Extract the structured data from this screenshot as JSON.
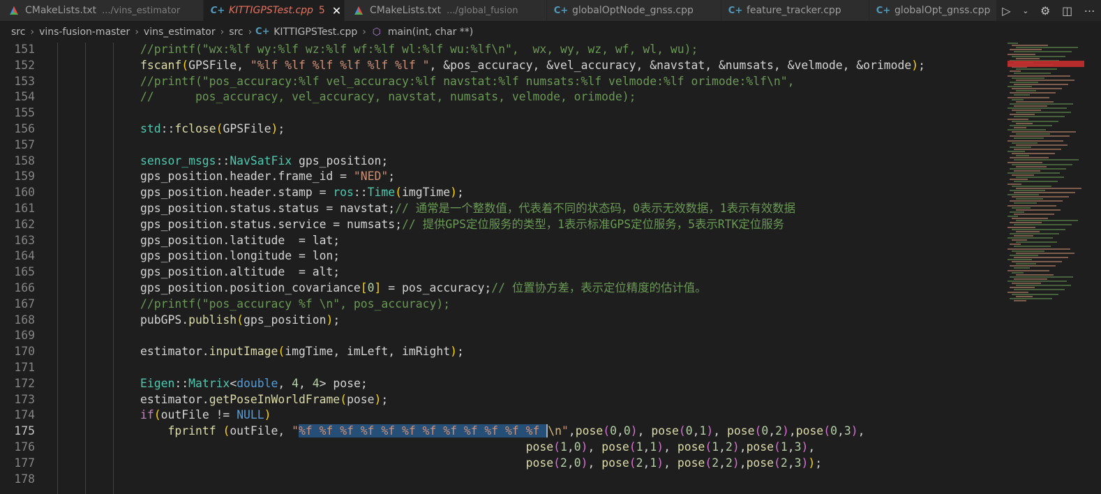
{
  "tabs": [
    {
      "label": "CMakeLists.txt",
      "desc": ".../vins_estimator",
      "icon": "cmake-icon",
      "active": false
    },
    {
      "label": "KITTIGPSTest.cpp",
      "desc": "",
      "badge": "5",
      "icon": "cpp-icon",
      "active": true
    },
    {
      "label": "CMakeLists.txt",
      "desc": ".../global_fusion",
      "icon": "cmake-icon",
      "active": false
    },
    {
      "label": "globalOptNode_gnss.cpp",
      "desc": "",
      "icon": "cpp-icon",
      "active": false
    },
    {
      "label": "feature_tracker.cpp",
      "desc": "",
      "icon": "cpp-icon",
      "active": false
    },
    {
      "label": "globalOpt_gnss.cpp",
      "desc": "",
      "icon": "cpp-icon",
      "active": false
    }
  ],
  "breadcrumb": {
    "items": [
      "src",
      "vins-fusion-master",
      "vins_estimator",
      "src",
      "KITTIGPSTest.cpp",
      "main(int, char **)"
    ]
  },
  "editor": {
    "current_line": "175",
    "lines": [
      {
        "n": "151",
        "tokens": [
          [
            "cmt",
            "//printf(\"wx:%lf wy:%lf wz:%lf wf:%lf wl:%lf wu:%lf\\n\",  wx, wy, wz, wf, wl, wu);"
          ]
        ]
      },
      {
        "n": "152",
        "tokens": [
          [
            "fn",
            "fscanf"
          ],
          [
            "p1",
            "("
          ],
          [
            "var",
            "GPSFile, "
          ],
          [
            "str",
            "\"%lf %lf %lf %lf %lf %lf \""
          ],
          [
            "var",
            ", &pos_accuracy, &vel_accuracy, &navstat, &numsats, &velmode, &orimode"
          ],
          [
            "p1",
            ")"
          ],
          [
            "var",
            ";"
          ]
        ]
      },
      {
        "n": "153",
        "tokens": [
          [
            "cmt",
            "//printf(\"pos_accuracy:%lf vel_accuracy:%lf navstat:%lf numsats:%lf velmode:%lf orimode:%lf\\n\","
          ]
        ]
      },
      {
        "n": "154",
        "tokens": [
          [
            "cmt",
            "//      pos_accuracy, vel_accuracy, navstat, numsats, velmode, orimode);"
          ]
        ]
      },
      {
        "n": "155",
        "tokens": []
      },
      {
        "n": "156",
        "tokens": [
          [
            "type",
            "std"
          ],
          [
            "var",
            "::"
          ],
          [
            "fn",
            "fclose"
          ],
          [
            "p1",
            "("
          ],
          [
            "var",
            "GPSFile"
          ],
          [
            "p1",
            ")"
          ],
          [
            "var",
            ";"
          ]
        ]
      },
      {
        "n": "157",
        "tokens": []
      },
      {
        "n": "158",
        "tokens": [
          [
            "type",
            "sensor_msgs"
          ],
          [
            "var",
            "::"
          ],
          [
            "type",
            "NavSatFix"
          ],
          [
            "var",
            " gps_position;"
          ]
        ]
      },
      {
        "n": "159",
        "tokens": [
          [
            "var",
            "gps_position.header.frame_id = "
          ],
          [
            "str",
            "\"NED\""
          ],
          [
            "var",
            ";"
          ]
        ]
      },
      {
        "n": "160",
        "tokens": [
          [
            "var",
            "gps_position.header.stamp = "
          ],
          [
            "type",
            "ros"
          ],
          [
            "var",
            "::"
          ],
          [
            "type",
            "Time"
          ],
          [
            "p1",
            "("
          ],
          [
            "var",
            "imgTime"
          ],
          [
            "p1",
            ")"
          ],
          [
            "var",
            ";"
          ]
        ]
      },
      {
        "n": "161",
        "tokens": [
          [
            "var",
            "gps_position.status.status = navstat;"
          ],
          [
            "cmt",
            "// 通常是一个整数值，代表着不同的状态码，0表示无效数据，1表示有效数据"
          ]
        ]
      },
      {
        "n": "162",
        "tokens": [
          [
            "var",
            "gps_position.status.service = numsats;"
          ],
          [
            "cmt",
            "// 提供GPS定位服务的类型，1表示标准GPS定位服务，5表示RTK定位服务"
          ]
        ]
      },
      {
        "n": "163",
        "tokens": [
          [
            "var",
            "gps_position.latitude  = lat;"
          ]
        ]
      },
      {
        "n": "164",
        "tokens": [
          [
            "var",
            "gps_position.longitude = lon;"
          ]
        ]
      },
      {
        "n": "165",
        "tokens": [
          [
            "var",
            "gps_position.altitude  = alt;"
          ]
        ]
      },
      {
        "n": "166",
        "tokens": [
          [
            "var",
            "gps_position.position_covariance"
          ],
          [
            "p1",
            "["
          ],
          [
            "num",
            "0"
          ],
          [
            "p1",
            "]"
          ],
          [
            "var",
            " = pos_accuracy;"
          ],
          [
            "cmt",
            "// 位置协方差，表示定位精度的估计值。"
          ]
        ]
      },
      {
        "n": "167",
        "tokens": [
          [
            "cmt",
            "//printf(\"pos_accuracy %f \\n\", pos_accuracy);"
          ]
        ]
      },
      {
        "n": "168",
        "tokens": [
          [
            "var",
            "pubGPS."
          ],
          [
            "fn",
            "publish"
          ],
          [
            "p1",
            "("
          ],
          [
            "var",
            "gps_position"
          ],
          [
            "p1",
            ")"
          ],
          [
            "var",
            ";"
          ]
        ]
      },
      {
        "n": "169",
        "tokens": []
      },
      {
        "n": "170",
        "tokens": [
          [
            "var",
            "estimator."
          ],
          [
            "fn",
            "inputImage"
          ],
          [
            "p1",
            "("
          ],
          [
            "var",
            "imgTime, imLeft, imRight"
          ],
          [
            "p1",
            ")"
          ],
          [
            "var",
            ";"
          ]
        ]
      },
      {
        "n": "171",
        "tokens": []
      },
      {
        "n": "172",
        "tokens": [
          [
            "type",
            "Eigen"
          ],
          [
            "var",
            "::"
          ],
          [
            "type",
            "Matrix"
          ],
          [
            "var",
            "<"
          ],
          [
            "kw",
            "double"
          ],
          [
            "var",
            ", "
          ],
          [
            "num",
            "4"
          ],
          [
            "var",
            ", "
          ],
          [
            "num",
            "4"
          ],
          [
            "var",
            "> pose;"
          ]
        ]
      },
      {
        "n": "173",
        "tokens": [
          [
            "var",
            "estimator."
          ],
          [
            "fn",
            "getPoseInWorldFrame"
          ],
          [
            "p1",
            "("
          ],
          [
            "var",
            "pose"
          ],
          [
            "p1",
            ")"
          ],
          [
            "var",
            ";"
          ]
        ]
      },
      {
        "n": "174",
        "tokens": [
          [
            "ctrl",
            "if"
          ],
          [
            "p1",
            "("
          ],
          [
            "var",
            "outFile != "
          ],
          [
            "kw",
            "NULL"
          ],
          [
            "p1",
            ")"
          ]
        ]
      },
      {
        "n": "175",
        "tokens": [
          [
            "var",
            "    "
          ],
          [
            "fn",
            "fprintf"
          ],
          [
            "var",
            " "
          ],
          [
            "p1",
            "("
          ],
          [
            "var",
            "outFile, "
          ],
          [
            "str",
            "\""
          ],
          [
            "sel",
            "%f %f %f %f %f %f %f %f %f %f %f %f "
          ],
          [
            "caret",
            ""
          ],
          [
            "esc",
            "\\n"
          ],
          [
            "str",
            "\""
          ],
          [
            "var",
            ","
          ],
          [
            "fn",
            "pose"
          ],
          [
            "p2",
            "("
          ],
          [
            "num",
            "0"
          ],
          [
            "var",
            ","
          ],
          [
            "num",
            "0"
          ],
          [
            "p2",
            ")"
          ],
          [
            "var",
            ", "
          ],
          [
            "fn",
            "pose"
          ],
          [
            "p2",
            "("
          ],
          [
            "num",
            "0"
          ],
          [
            "var",
            ","
          ],
          [
            "num",
            "1"
          ],
          [
            "p2",
            ")"
          ],
          [
            "var",
            ", "
          ],
          [
            "fn",
            "pose"
          ],
          [
            "p2",
            "("
          ],
          [
            "num",
            "0"
          ],
          [
            "var",
            ","
          ],
          [
            "num",
            "2"
          ],
          [
            "p2",
            ")"
          ],
          [
            "var",
            ","
          ],
          [
            "fn",
            "pose"
          ],
          [
            "p2",
            "("
          ],
          [
            "num",
            "0"
          ],
          [
            "var",
            ","
          ],
          [
            "num",
            "3"
          ],
          [
            "p2",
            ")"
          ],
          [
            "var",
            ","
          ]
        ]
      },
      {
        "n": "176",
        "tokens": [
          [
            "var",
            "                                                        "
          ],
          [
            "fn",
            "pose"
          ],
          [
            "p2",
            "("
          ],
          [
            "num",
            "1"
          ],
          [
            "var",
            ","
          ],
          [
            "num",
            "0"
          ],
          [
            "p2",
            ")"
          ],
          [
            "var",
            ", "
          ],
          [
            "fn",
            "pose"
          ],
          [
            "p2",
            "("
          ],
          [
            "num",
            "1"
          ],
          [
            "var",
            ","
          ],
          [
            "num",
            "1"
          ],
          [
            "p2",
            ")"
          ],
          [
            "var",
            ", "
          ],
          [
            "fn",
            "pose"
          ],
          [
            "p2",
            "("
          ],
          [
            "num",
            "1"
          ],
          [
            "var",
            ","
          ],
          [
            "num",
            "2"
          ],
          [
            "p2",
            ")"
          ],
          [
            "var",
            ","
          ],
          [
            "fn",
            "pose"
          ],
          [
            "p2",
            "("
          ],
          [
            "num",
            "1"
          ],
          [
            "var",
            ","
          ],
          [
            "num",
            "3"
          ],
          [
            "p2",
            ")"
          ],
          [
            "var",
            ","
          ]
        ]
      },
      {
        "n": "177",
        "tokens": [
          [
            "var",
            "                                                        "
          ],
          [
            "fn",
            "pose"
          ],
          [
            "p2",
            "("
          ],
          [
            "num",
            "2"
          ],
          [
            "var",
            ","
          ],
          [
            "num",
            "0"
          ],
          [
            "p2",
            ")"
          ],
          [
            "var",
            ", "
          ],
          [
            "fn",
            "pose"
          ],
          [
            "p2",
            "("
          ],
          [
            "num",
            "2"
          ],
          [
            "var",
            ","
          ],
          [
            "num",
            "1"
          ],
          [
            "p2",
            ")"
          ],
          [
            "var",
            ", "
          ],
          [
            "fn",
            "pose"
          ],
          [
            "p2",
            "("
          ],
          [
            "num",
            "2"
          ],
          [
            "var",
            ","
          ],
          [
            "num",
            "2"
          ],
          [
            "p2",
            ")"
          ],
          [
            "var",
            ","
          ],
          [
            "fn",
            "pose"
          ],
          [
            "p2",
            "("
          ],
          [
            "num",
            "2"
          ],
          [
            "var",
            ","
          ],
          [
            "num",
            "3"
          ],
          [
            "p2",
            ")"
          ],
          [
            "p1",
            ")"
          ],
          [
            "var",
            ";"
          ]
        ]
      },
      {
        "n": "178",
        "tokens": []
      }
    ]
  }
}
